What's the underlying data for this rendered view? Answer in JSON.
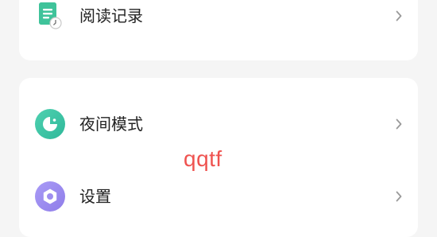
{
  "menu": {
    "items": [
      {
        "id": "reading-history",
        "label": "阅读记录",
        "icon": "document-clock-icon",
        "icon_color": "#3fc39a"
      },
      {
        "id": "night-mode",
        "label": "夜间模式",
        "icon": "moon-icon",
        "icon_color": "#3cc6a3"
      },
      {
        "id": "settings",
        "label": "设置",
        "icon": "hexagon-gear-icon",
        "icon_color": "#9f8ef0"
      }
    ]
  },
  "overlay": {
    "watermark_text": "qqtf",
    "watermark_color": "#ef5350"
  },
  "colors": {
    "background": "#f5f5f5",
    "card": "#ffffff",
    "chevron": "#9a9a9a"
  }
}
